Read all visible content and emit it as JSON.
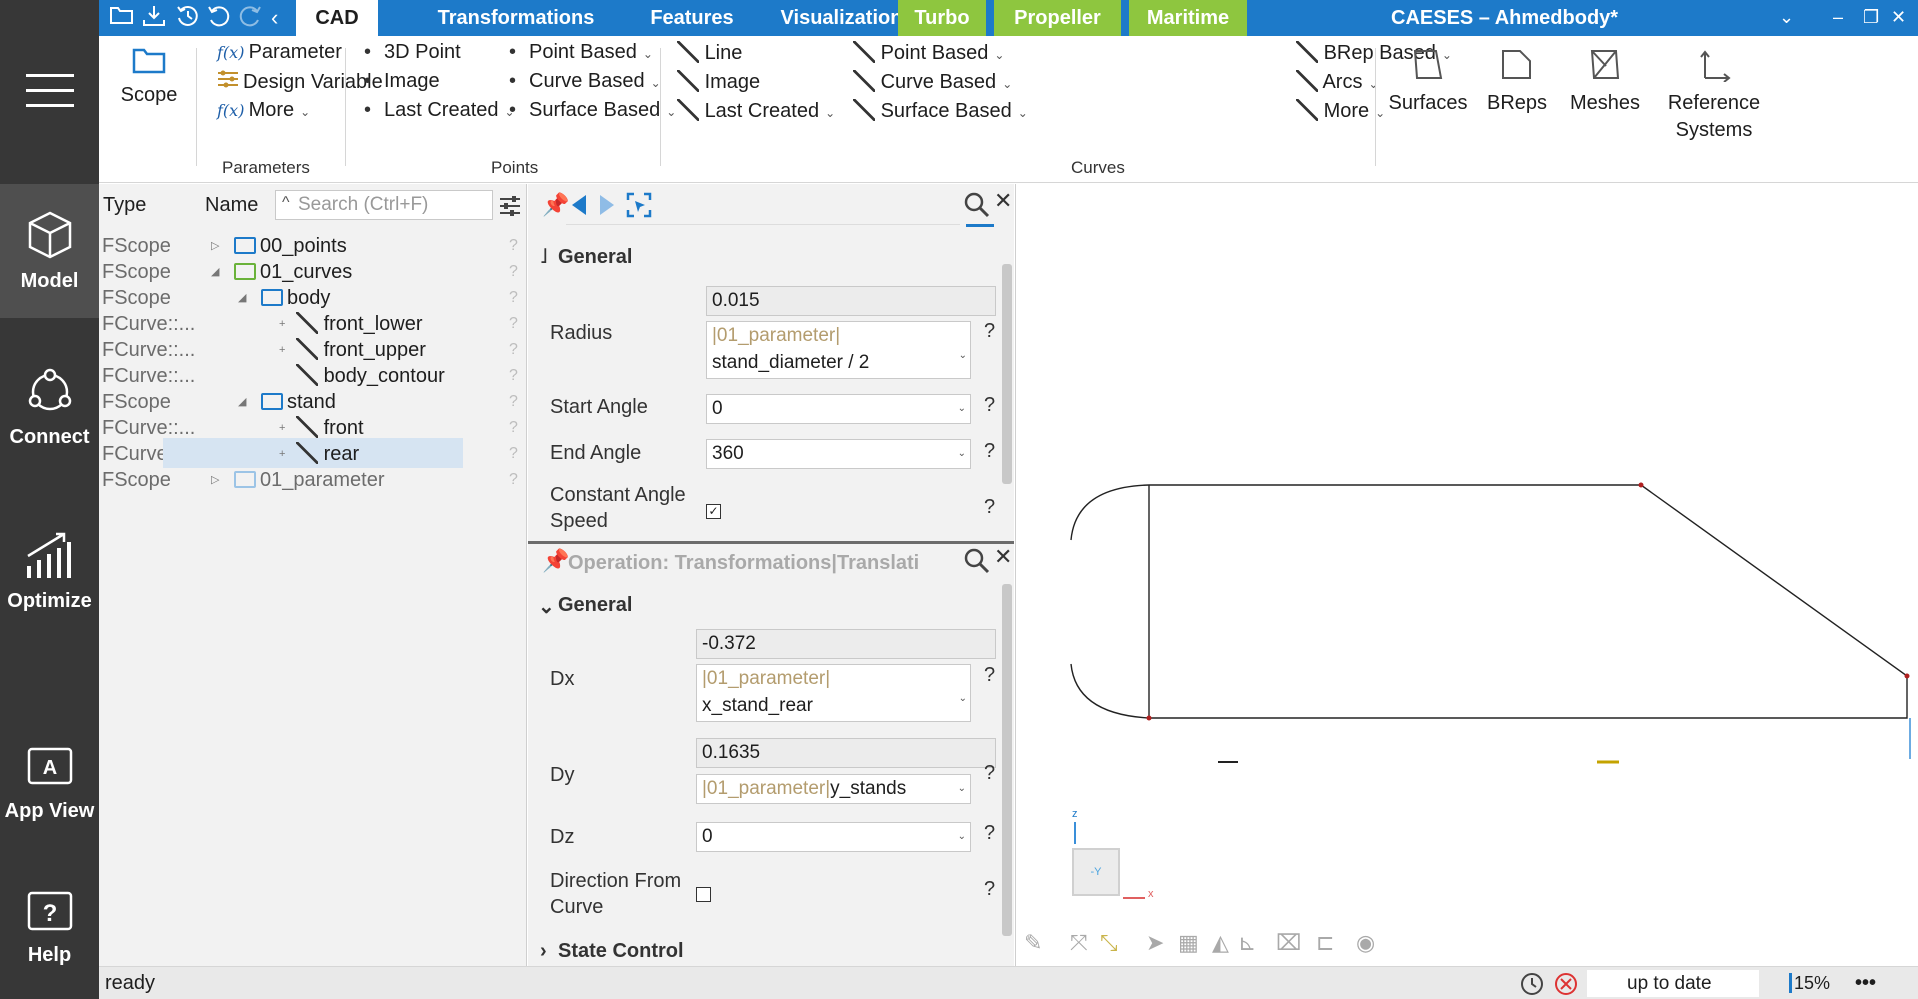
{
  "sidebar": {
    "items": [
      {
        "label": "Model"
      },
      {
        "label": "Connect"
      },
      {
        "label": "Optimize"
      },
      {
        "label": "App View"
      },
      {
        "label": "Help"
      }
    ]
  },
  "titlebar": {
    "tabs": [
      "CAD",
      "Transformations",
      "Features",
      "Visualization",
      "Turbo",
      "Propeller",
      "Maritime"
    ],
    "app_title": "CAESES – Ahmedbody*"
  },
  "ribbon": {
    "scope_label": "Scope",
    "parameters": {
      "items": [
        "Parameter",
        "Design Variable",
        "More"
      ],
      "group": "Parameters",
      "fx": "f(x)"
    },
    "points": {
      "col1": [
        "3D Point",
        "Image",
        "Last Created"
      ],
      "col2": [
        "Point Based",
        "Curve Based",
        "Surface Based"
      ],
      "group": "Points"
    },
    "curves": {
      "col1": [
        "Line",
        "Image",
        "Last Created"
      ],
      "col2": [
        "Point Based",
        "Curve Based",
        "Surface Based"
      ],
      "col3": [
        "BRep Based",
        "Arcs",
        "More"
      ],
      "group": "Curves"
    },
    "big_buttons": [
      "Surfaces",
      "BReps",
      "Meshes",
      "Reference Systems"
    ]
  },
  "tree": {
    "header_type": "Type",
    "header_name": "Name",
    "search_placeholder": "Search (Ctrl+F)",
    "rows": [
      {
        "type": "FScope",
        "name": "00_points"
      },
      {
        "type": "FScope",
        "name": "01_curves"
      },
      {
        "type": "FScope",
        "name": "body"
      },
      {
        "type": "FCurve::...",
        "name": "front_lower"
      },
      {
        "type": "FCurve::...",
        "name": "front_upper"
      },
      {
        "type": "FCurve::...",
        "name": "body_contour"
      },
      {
        "type": "FScope",
        "name": "stand"
      },
      {
        "type": "FCurve::...",
        "name": "front"
      },
      {
        "type": "FCurve::...",
        "name": "rear"
      },
      {
        "type": "FScope",
        "name": "01_parameter"
      }
    ],
    "qmark": "?"
  },
  "panel1": {
    "section": "General",
    "radius_label": "Radius",
    "radius_value": "0.015",
    "radius_expr_param": "|01_parameter|",
    "radius_expr_rest": "stand_diameter / 2",
    "start_angle_label": "Start Angle",
    "start_angle": "0",
    "end_angle_label": "End Angle",
    "end_angle": "360",
    "constant_label_1": "Constant Angle",
    "constant_label_2": "Speed"
  },
  "panel2": {
    "title": "Operation: Transformations|Translati",
    "section": "General",
    "dx_label": "Dx",
    "dx_value": "-0.372",
    "dx_expr_param": "|01_parameter|",
    "dx_expr_rest": "x_stand_rear",
    "dy_label": "Dy",
    "dy_value": "0.1635",
    "dy_expr_param": "|01_parameter|",
    "dy_expr_rest": "y_stands",
    "dz_label": "Dz",
    "dz_value": "0",
    "dir_label_1": "Direction From",
    "dir_label_2": "Curve",
    "state_control": "State Control"
  },
  "viewport": {
    "axis_z": "z",
    "axis_x": "x",
    "cube_face": "-Y"
  },
  "status": {
    "text": "ready",
    "state": "up to date",
    "zoom": "15%",
    "more": "•••"
  },
  "colors": {
    "titlebar": "#1d7ac9",
    "green_tab": "#8ec63f",
    "sidebar": "#373737",
    "param_text": "#b39c6e",
    "selection": "#d6e4f2"
  }
}
